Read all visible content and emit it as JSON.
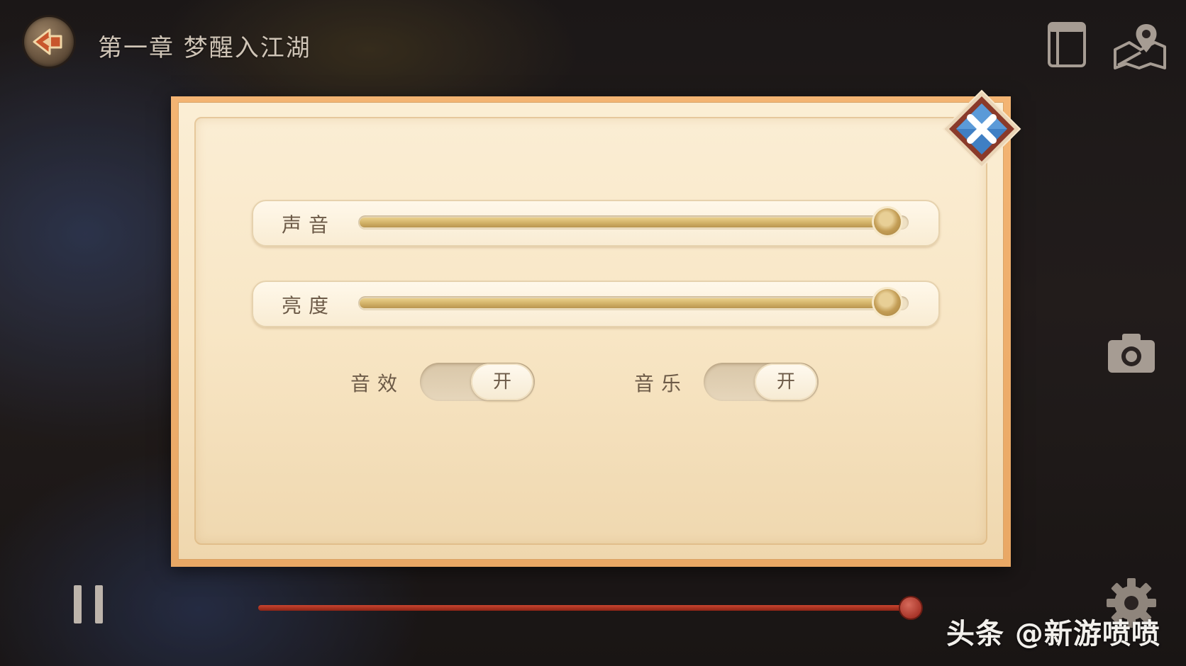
{
  "header": {
    "chapter_title": "第一章 梦醒入江湖",
    "back_icon": "back-arrow-icon",
    "book_icon": "book-icon",
    "map_icon": "map-pin-icon"
  },
  "settings_dialog": {
    "close_icon": "close-icon",
    "sliders": [
      {
        "label": "声音",
        "value_percent": 100
      },
      {
        "label": "亮度",
        "value_percent": 100
      }
    ],
    "toggles": [
      {
        "label": "音效",
        "state_text": "开"
      },
      {
        "label": "音乐",
        "state_text": "开"
      }
    ]
  },
  "side_controls": {
    "camera_icon": "camera-icon",
    "gear_icon": "gear-icon"
  },
  "playback": {
    "pause_icon": "pause-icon",
    "progress_percent": 100
  },
  "watermark": "头条 @新游喷喷",
  "colors": {
    "dialog_border": "#f3b473",
    "dialog_bg": "#fbeed5",
    "slider_fill": "#cfae64",
    "progress_fill": "#c8442f",
    "close_button": "#3f7fc4",
    "text_brown": "#6c5a47"
  }
}
